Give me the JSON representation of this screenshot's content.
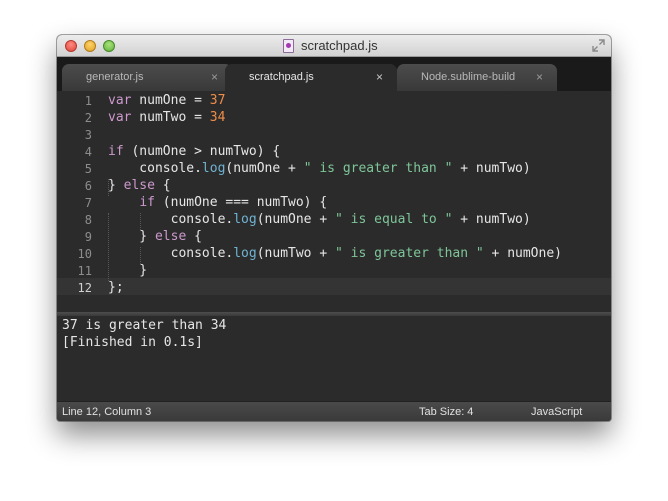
{
  "window": {
    "title": "scratchpad.js"
  },
  "tabs": [
    {
      "label": "generator.js",
      "close": "×",
      "active": false
    },
    {
      "label": "scratchpad.js",
      "close": "×",
      "active": true
    },
    {
      "label": "Node.sublime-build",
      "close": "×",
      "active": false
    }
  ],
  "editor": {
    "line_numbers": [
      "1",
      "2",
      "3",
      "4",
      "5",
      "6",
      "7",
      "8",
      "9",
      "10",
      "11",
      "12"
    ],
    "current_line": 12,
    "lines": [
      "var numOne = 37",
      "var numTwo = 34",
      "",
      "if (numOne > numTwo) {",
      "    console.log(numOne + \" is greater than \" + numTwo)",
      "} else {",
      "    if (numOne === numTwo) {",
      "        console.log(numOne + \" is equal to \" + numTwo)",
      "    } else {",
      "        console.log(numTwo + \" is greater than \" + numOne)",
      "    }",
      "};"
    ]
  },
  "output": {
    "lines": [
      "37 is greater than 34",
      "[Finished in 0.1s]"
    ]
  },
  "status": {
    "position": "Line 12, Column 3",
    "tab_size": "Tab Size: 4",
    "syntax": "JavaScript"
  },
  "colors": {
    "keyword": "#cc99cd",
    "number": "#f08d49",
    "string": "#7ec699",
    "function": "#6fb3d2",
    "text": "#e6e6e6",
    "background": "#2b2b2b"
  }
}
